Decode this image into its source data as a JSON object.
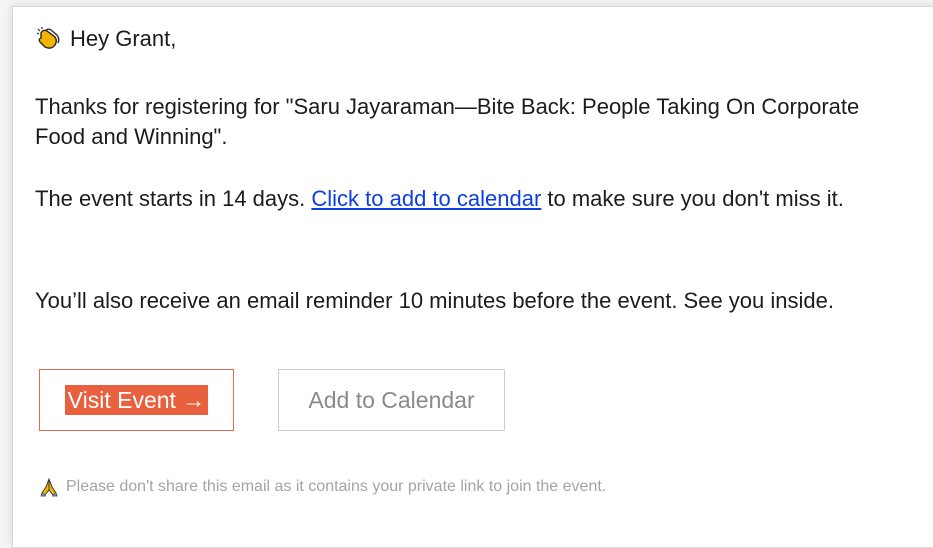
{
  "email": {
    "greeting": "Hey Grant,",
    "greeting_icon": "clapping-hands-icon",
    "paragraph1": "Thanks for registering for \"Saru Jayaraman—Bite Back: People Taking On Corporate Food and Winning\".",
    "paragraph2_before": "The event starts in 14 days. ",
    "paragraph2_link": "Click to add to calendar",
    "paragraph2_after": " to make sure you don't miss it.",
    "paragraph3": "You’ll also receive an email reminder 10 minutes before the event. See you inside.",
    "visit_button_label": "Visit Event →",
    "calendar_button_label": "Add to Calendar",
    "footer_icon": "folded-hands-icon",
    "footer_note": "Please don't share this email as it contains your private link to join the event."
  },
  "colors": {
    "accent": "#e9603f",
    "link": "#0b3ee6",
    "muted_text": "#a4a4a4"
  }
}
